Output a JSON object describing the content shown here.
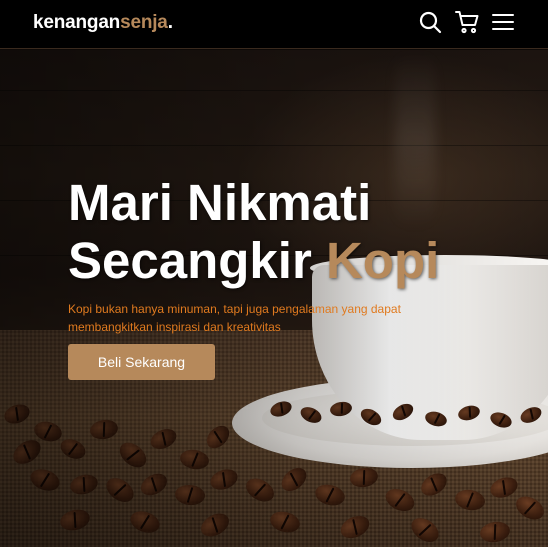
{
  "brand": {
    "part1": "kenangan",
    "part2": "senja",
    "part3": "."
  },
  "nav": {
    "icons": [
      "search-icon",
      "shopping-cart-icon",
      "hamburger-menu-icon"
    ]
  },
  "hero": {
    "title_line1": "Mari Nikmati",
    "title_line2_prefix": "Secangkir ",
    "title_line2_accent": "Kopi",
    "description": "Kopi bukan hanya minuman, tapi juga pengalaman yang dapat membangkitkan inspirasi dan kreativitas",
    "cta_label": "Beli Sekarang"
  },
  "colors": {
    "accent": "#b6895b",
    "description_text": "#e07a1f",
    "navbar_bg": "#000000",
    "text": "#ffffff"
  }
}
